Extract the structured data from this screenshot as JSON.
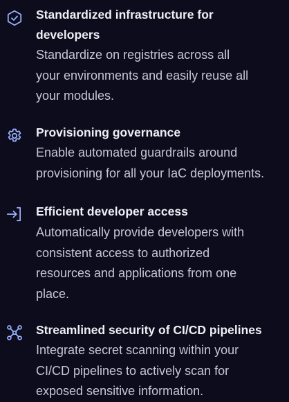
{
  "features": [
    {
      "icon": "shield-check-icon",
      "title_line1": "Standardized infrastructure for",
      "title_line2": "developers",
      "desc_lines": [
        "Standardize on registries across all",
        "your environments and easily reuse all",
        "your modules."
      ]
    },
    {
      "icon": "gear-icon",
      "title_line1": "Provisioning governance",
      "desc_lines": [
        "Enable automated guardrails around",
        "provisioning for all your IaC deployments."
      ]
    },
    {
      "icon": "sign-in-icon",
      "title_line1": "Efficient developer access",
      "desc_lines": [
        "Automatically provide developers with",
        "consistent access to authorized",
        "resources and applications from one",
        "place."
      ]
    },
    {
      "icon": "network-nodes-icon",
      "title_line1": "Streamlined security of CI/CD pipelines",
      "desc_lines": [
        "Integrate secret scanning within your",
        "CI/CD pipelines to actively scan for",
        "exposed sensitive information."
      ]
    }
  ],
  "colors": {
    "background": "#0d0c1d",
    "icon": "#9bb3ff",
    "title": "#eeeef4",
    "body": "#c6c7d4"
  }
}
